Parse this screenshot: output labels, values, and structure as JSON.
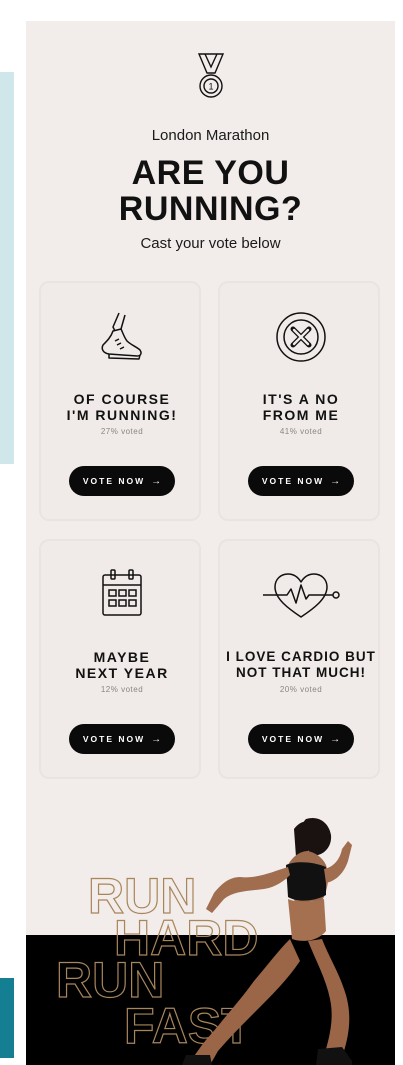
{
  "header": {
    "eyebrow": "London Marathon",
    "headline": "ARE YOU\nRUNNING?",
    "subhead": "Cast your vote below"
  },
  "options": [
    {
      "title": "OF COURSE\nI'M RUNNING!",
      "percent_label": "27% voted",
      "button": "VOTE NOW",
      "icon": "running-shoe-icon"
    },
    {
      "title": "IT'S A NO\nFROM ME",
      "percent_label": "41% voted",
      "button": "VOTE NOW",
      "icon": "x-circle-icon"
    },
    {
      "title": "MAYBE\nNEXT YEAR",
      "percent_label": "12% voted",
      "button": "VOTE NOW",
      "icon": "calendar-icon"
    },
    {
      "title": "I LOVE CARDIO BUT\nNOT THAT MUCH!",
      "percent_label": "20% voted",
      "button": "VOTE NOW",
      "icon": "heart-pulse-icon"
    }
  ],
  "hero": {
    "word_1": "RUN",
    "word_2": "HARD",
    "word_3": "RUN",
    "word_4": "FAST"
  },
  "colors": {
    "background": "#f2ecea",
    "card": "#f0eae8",
    "button": "#0a0a0a",
    "outline_gold": "#a8865c",
    "strip_top": "#cfe6ea",
    "strip_bottom": "#147f92"
  }
}
